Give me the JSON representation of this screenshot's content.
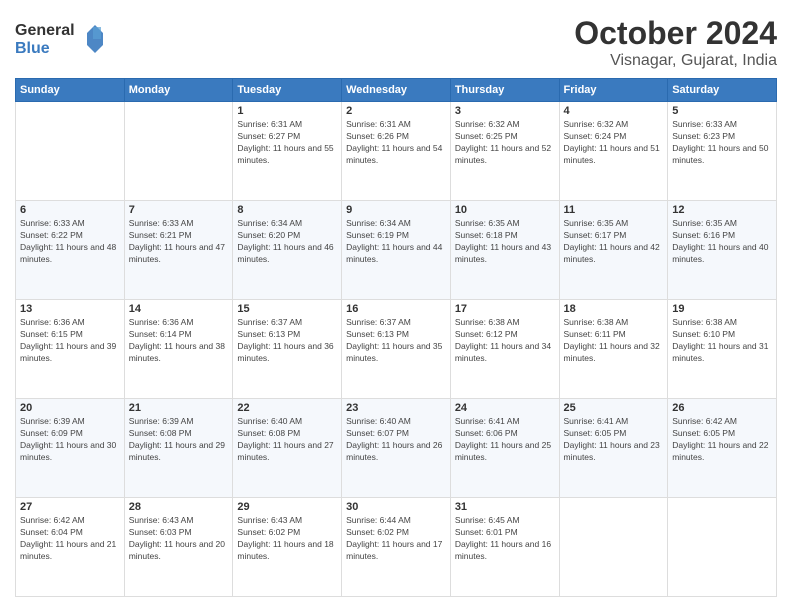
{
  "logo": {
    "line1": "General",
    "line2": "Blue"
  },
  "title": "October 2024",
  "location": "Visnagar, Gujarat, India",
  "weekdays": [
    "Sunday",
    "Monday",
    "Tuesday",
    "Wednesday",
    "Thursday",
    "Friday",
    "Saturday"
  ],
  "weeks": [
    [
      {
        "day": "",
        "info": ""
      },
      {
        "day": "",
        "info": ""
      },
      {
        "day": "1",
        "info": "Sunrise: 6:31 AM\nSunset: 6:27 PM\nDaylight: 11 hours and 55 minutes."
      },
      {
        "day": "2",
        "info": "Sunrise: 6:31 AM\nSunset: 6:26 PM\nDaylight: 11 hours and 54 minutes."
      },
      {
        "day": "3",
        "info": "Sunrise: 6:32 AM\nSunset: 6:25 PM\nDaylight: 11 hours and 52 minutes."
      },
      {
        "day": "4",
        "info": "Sunrise: 6:32 AM\nSunset: 6:24 PM\nDaylight: 11 hours and 51 minutes."
      },
      {
        "day": "5",
        "info": "Sunrise: 6:33 AM\nSunset: 6:23 PM\nDaylight: 11 hours and 50 minutes."
      }
    ],
    [
      {
        "day": "6",
        "info": "Sunrise: 6:33 AM\nSunset: 6:22 PM\nDaylight: 11 hours and 48 minutes."
      },
      {
        "day": "7",
        "info": "Sunrise: 6:33 AM\nSunset: 6:21 PM\nDaylight: 11 hours and 47 minutes."
      },
      {
        "day": "8",
        "info": "Sunrise: 6:34 AM\nSunset: 6:20 PM\nDaylight: 11 hours and 46 minutes."
      },
      {
        "day": "9",
        "info": "Sunrise: 6:34 AM\nSunset: 6:19 PM\nDaylight: 11 hours and 44 minutes."
      },
      {
        "day": "10",
        "info": "Sunrise: 6:35 AM\nSunset: 6:18 PM\nDaylight: 11 hours and 43 minutes."
      },
      {
        "day": "11",
        "info": "Sunrise: 6:35 AM\nSunset: 6:17 PM\nDaylight: 11 hours and 42 minutes."
      },
      {
        "day": "12",
        "info": "Sunrise: 6:35 AM\nSunset: 6:16 PM\nDaylight: 11 hours and 40 minutes."
      }
    ],
    [
      {
        "day": "13",
        "info": "Sunrise: 6:36 AM\nSunset: 6:15 PM\nDaylight: 11 hours and 39 minutes."
      },
      {
        "day": "14",
        "info": "Sunrise: 6:36 AM\nSunset: 6:14 PM\nDaylight: 11 hours and 38 minutes."
      },
      {
        "day": "15",
        "info": "Sunrise: 6:37 AM\nSunset: 6:13 PM\nDaylight: 11 hours and 36 minutes."
      },
      {
        "day": "16",
        "info": "Sunrise: 6:37 AM\nSunset: 6:13 PM\nDaylight: 11 hours and 35 minutes."
      },
      {
        "day": "17",
        "info": "Sunrise: 6:38 AM\nSunset: 6:12 PM\nDaylight: 11 hours and 34 minutes."
      },
      {
        "day": "18",
        "info": "Sunrise: 6:38 AM\nSunset: 6:11 PM\nDaylight: 11 hours and 32 minutes."
      },
      {
        "day": "19",
        "info": "Sunrise: 6:38 AM\nSunset: 6:10 PM\nDaylight: 11 hours and 31 minutes."
      }
    ],
    [
      {
        "day": "20",
        "info": "Sunrise: 6:39 AM\nSunset: 6:09 PM\nDaylight: 11 hours and 30 minutes."
      },
      {
        "day": "21",
        "info": "Sunrise: 6:39 AM\nSunset: 6:08 PM\nDaylight: 11 hours and 29 minutes."
      },
      {
        "day": "22",
        "info": "Sunrise: 6:40 AM\nSunset: 6:08 PM\nDaylight: 11 hours and 27 minutes."
      },
      {
        "day": "23",
        "info": "Sunrise: 6:40 AM\nSunset: 6:07 PM\nDaylight: 11 hours and 26 minutes."
      },
      {
        "day": "24",
        "info": "Sunrise: 6:41 AM\nSunset: 6:06 PM\nDaylight: 11 hours and 25 minutes."
      },
      {
        "day": "25",
        "info": "Sunrise: 6:41 AM\nSunset: 6:05 PM\nDaylight: 11 hours and 23 minutes."
      },
      {
        "day": "26",
        "info": "Sunrise: 6:42 AM\nSunset: 6:05 PM\nDaylight: 11 hours and 22 minutes."
      }
    ],
    [
      {
        "day": "27",
        "info": "Sunrise: 6:42 AM\nSunset: 6:04 PM\nDaylight: 11 hours and 21 minutes."
      },
      {
        "day": "28",
        "info": "Sunrise: 6:43 AM\nSunset: 6:03 PM\nDaylight: 11 hours and 20 minutes."
      },
      {
        "day": "29",
        "info": "Sunrise: 6:43 AM\nSunset: 6:02 PM\nDaylight: 11 hours and 18 minutes."
      },
      {
        "day": "30",
        "info": "Sunrise: 6:44 AM\nSunset: 6:02 PM\nDaylight: 11 hours and 17 minutes."
      },
      {
        "day": "31",
        "info": "Sunrise: 6:45 AM\nSunset: 6:01 PM\nDaylight: 11 hours and 16 minutes."
      },
      {
        "day": "",
        "info": ""
      },
      {
        "day": "",
        "info": ""
      }
    ]
  ]
}
